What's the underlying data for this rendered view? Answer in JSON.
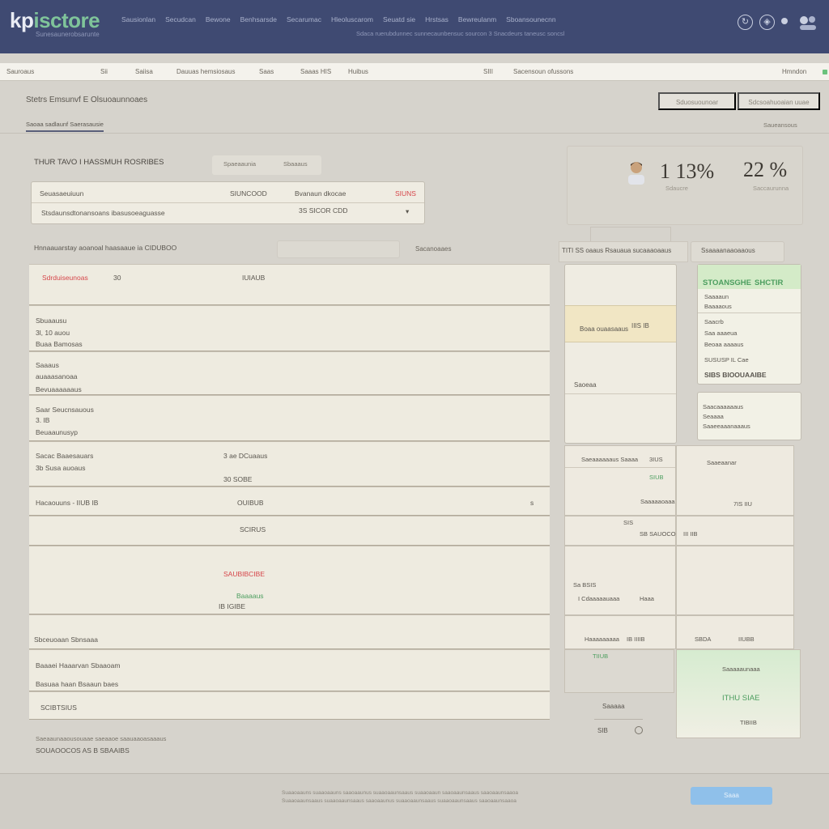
{
  "header": {
    "logo_a": "kp",
    "logo_b": "isctore",
    "tagline": "Sunesaunerobsarunte",
    "nav": [
      "Sausionlan",
      "Secudcan",
      "Bewone",
      "Benhsarsde",
      "Secarumac",
      "Hleoluscarom",
      "Seuatd sie",
      "Hrstsas",
      "Bewreulanm",
      "Sboansounecnn"
    ],
    "subline": "Sdaca ruerubdunnec sunnecaunbensuc sourcon 3 Snacdeurs taneusc soncsl"
  },
  "subnav": [
    "Sauroaus",
    "Sii",
    "Saiisa",
    "Dauuas hemsiosaus",
    "Saas",
    "Saaas HIS",
    "Huibus",
    "SIII",
    "Sacensoun ofussons",
    "Hmndon"
  ],
  "page": {
    "title": "Stetrs Emsunvf E Olsuoaunnoaes",
    "tab": "Saoaa sadlaunf Saerasausie",
    "top_buttons": [
      "Sduosuounoar",
      "Sdcsoahuoaian uuae"
    ],
    "right_link": "Saueansous"
  },
  "summary": {
    "title": "THUR TAVO I HASSMUH ROSRIBES",
    "pills": [
      "Spaeaaunia",
      "Sbaaaus"
    ],
    "line1": [
      "Seuasaeuiuun",
      "SIUNCOOD",
      "Bvanaun dkocae",
      "SIUNS"
    ],
    "line2": [
      "Stsdaunsdtonansoans ibasusoeaguasse",
      "3S SICOR CDD"
    ]
  },
  "stats": {
    "pct1": "1 13%",
    "pct2": "22 %",
    "sub1": "Sdaucre",
    "sub2": "Saccaurunna"
  },
  "list": {
    "title": "Hnnaauarstay aoanoal haasaaue ia CIDUBOO",
    "search_placeholder": "",
    "filter": "Sacanoaaes",
    "rows": [
      [
        "Sdrduiseunoas",
        "30",
        "IUIAUB"
      ],
      [
        "Sbuaausu",
        "3l, 10 auou",
        "Buaa Bamosas"
      ],
      [
        "Saaaus",
        "auaaasanoaa",
        "Bevuaaaaaaus"
      ],
      [
        "Saar Seucnsauous",
        "3. IB",
        "Beuaaunusyp"
      ],
      [
        "Sacac Baaesauars",
        "3b Susa auoaus",
        "3 ae DCuaaus",
        "30 SOBE"
      ],
      [
        "Hacaouuns - IIUB IB",
        "OUIBUB",
        "s"
      ],
      [
        "SCIRUS"
      ],
      [
        "SAUBIBCIBE",
        "Baaaaus",
        "IB IGIBE"
      ],
      [
        "Sbceuoaan Sbnsaaa"
      ],
      [
        "Baaaei Haaarvan Sbaaoam",
        "Basuaa haan Bsaaun baes"
      ],
      [
        "SCIBTSIUS"
      ]
    ],
    "footnote": "Saeaaunaaousouaae saeaaoe saauaaoasaaaus",
    "footnote2": "SOUAOOCOS AS B SBAAIBS"
  },
  "side": {
    "header_left": "TITI SS oaaus Rsauaua sucaaaoaaus",
    "header_right": "Ssaaaanaaoaaous",
    "c1": [
      "Boaa ouaasaaus",
      "IIIS IB",
      "Saoeaa"
    ],
    "g1": [
      "STOANSGHE",
      "SHCTIR",
      "Saaaaun",
      "Baaaaous"
    ],
    "g2": [
      "Saacrb",
      "Saa aaaeua",
      "Beoaa aaaaus",
      "SUSUSP IL Cae",
      "SIBS BIOOUAAIBE"
    ],
    "g3": [
      "Saacaaaaaaus",
      "Seaaaa",
      "Saaeeaaanaaaus"
    ],
    "p": [
      "Saeaaaaaaus Saaaa",
      "3IUS",
      "SIUB",
      "Saaaaaoaaa",
      "Saaeaanar",
      "7IS IIU",
      "SIS",
      "SB SAUOCOOB",
      "III IIB",
      "Sa BSIS",
      "Haaa",
      "I Cdaaaaauaaa",
      "Haaaaaaaaa",
      "IB IIIIB",
      "SBDA",
      "IIUBB",
      "TIIUB",
      "Saaaaaunaaa",
      "ITHU SIAE",
      "TIBIIB"
    ],
    "mini": [
      "Saaaaa",
      "SIB"
    ]
  },
  "footer": {
    "line1": "Suaaoaauns suaaoaauns saaoaaunus suaaoaaunsaaus suaaoaaun saaoaaunsaaus saaoaaunsaaoa",
    "line2": "Suaaoaaunsaaus suaaoaaunsaaus saaoaaunus suaaoaaunsaaus suaaoaaunsaaus saaoaaunsaaoa",
    "cta": "Saaa"
  }
}
